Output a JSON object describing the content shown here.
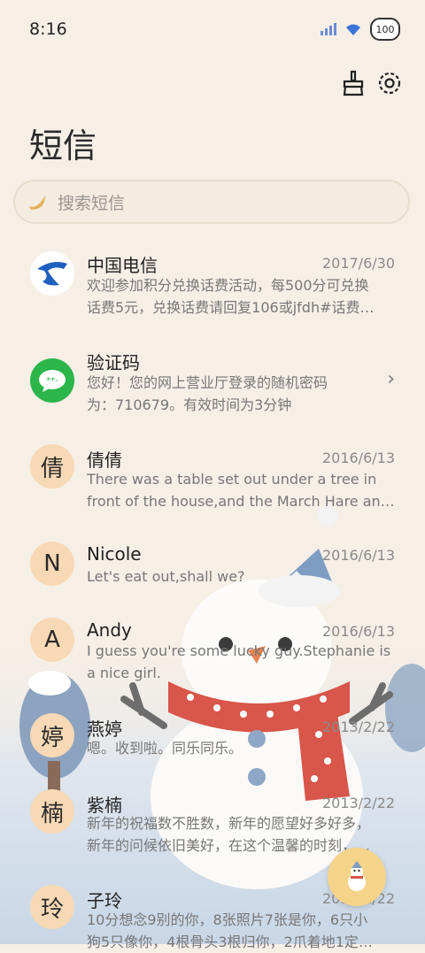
{
  "status": {
    "time": "8:16",
    "battery": "100"
  },
  "header": {
    "title": "短信"
  },
  "search": {
    "placeholder": "搜索短信"
  },
  "messages": [
    {
      "name": "中国电信",
      "date": "2017/6/30",
      "line1": "欢迎参加积分兑换话费活动，每500分可兑换",
      "line2": "话费5元，兑换话费请回复106或jfdh#话费…"
    },
    {
      "name": "验证码",
      "date": "",
      "line1": "您好！您的网上营业厅登录的随机密码",
      "line2": "为：710679。有效时间为3分钟"
    },
    {
      "name": "倩倩",
      "avatar": "倩",
      "date": "2016/6/13",
      "line1": "There was a table set out under a tree in",
      "line2": "front of the house,and the March Hare an…"
    },
    {
      "name": "Nicole",
      "avatar": "N",
      "date": "2016/6/13",
      "line1": "Let's eat out,shall we?",
      "line2": ""
    },
    {
      "name": "Andy",
      "avatar": "A",
      "date": "2016/6/13",
      "line1": "I guess you're some lucky guy.Stephanie is",
      "line2": "a nice girl."
    },
    {
      "name": "燕婷",
      "avatar": "婷",
      "date": "2013/2/22",
      "line1": "嗯。收到啦。同乐同乐。",
      "line2": ""
    },
    {
      "name": "紫楠",
      "avatar": "楠",
      "date": "2013/2/22",
      "line1": "新年的祝福数不胜数，新年的愿望好多好多，",
      "line2": "新年的问候依旧美好，在这个温馨的时刻，…"
    },
    {
      "name": "子玲",
      "avatar": "玲",
      "date": "2013/2/22",
      "line1": "10分想念9别的你，8张照片7张是你，6只小",
      "line2": "狗5只像你，4根骨头3根归你，2爪着地1定…"
    }
  ],
  "colors": {
    "background": "#f6efe6",
    "avatar_bg": "#f7d9b5",
    "fab_bg": "#f5d48a"
  }
}
